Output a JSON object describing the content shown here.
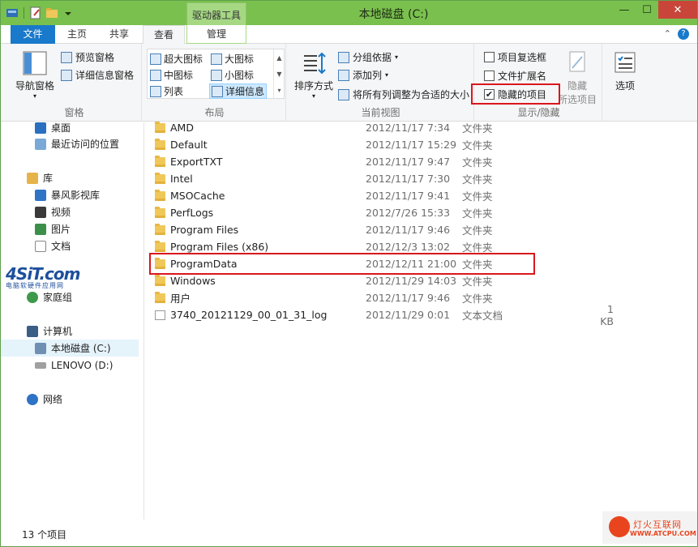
{
  "window": {
    "title": "本地磁盘 (C:)",
    "context_tab_group": "驱动器工具"
  },
  "tabs": {
    "file": "文件",
    "home": "主页",
    "share": "共享",
    "view": "查看",
    "manage": "管理"
  },
  "ribbon": {
    "pane": {
      "nav_pane": "导航窗格",
      "preview_pane": "预览窗格",
      "details_pane": "详细信息窗格",
      "label": "窗格"
    },
    "layout": {
      "xl_icons": "超大图标",
      "large_icons": "大图标",
      "medium_icons": "中图标",
      "small_icons": "小图标",
      "list": "列表",
      "details": "详细信息",
      "label": "布局"
    },
    "current_view": {
      "sort_by": "排序方式",
      "group_by": "分组依据",
      "add_column": "添加列",
      "fit_columns": "将所有列调整为合适的大小",
      "label": "当前视图"
    },
    "show_hide": {
      "item_checkboxes": "项目复选框",
      "file_extensions": "文件扩展名",
      "hidden_items": "隐藏的项目",
      "hide_selected_1": "隐藏",
      "hide_selected_2": "所选项目",
      "label": "显示/隐藏"
    },
    "options": "选项"
  },
  "nav": {
    "items": [
      {
        "label": "桌面"
      },
      {
        "label": "最近访问的位置"
      },
      {
        "label": "库"
      },
      {
        "label": "暴风影视库"
      },
      {
        "label": "视频"
      },
      {
        "label": "图片"
      },
      {
        "label": "文档"
      },
      {
        "label": "家庭组"
      },
      {
        "label": "计算机"
      },
      {
        "label": "本地磁盘 (C:)"
      },
      {
        "label": "LENOVO (D:)"
      },
      {
        "label": "网络"
      }
    ]
  },
  "files": [
    {
      "name": "AMD",
      "date": "2012/11/17 7:34",
      "type": "文件夹",
      "size": ""
    },
    {
      "name": "Default",
      "date": "2012/11/17 15:29",
      "type": "文件夹",
      "size": ""
    },
    {
      "name": "ExportTXT",
      "date": "2012/11/17 9:47",
      "type": "文件夹",
      "size": ""
    },
    {
      "name": "Intel",
      "date": "2012/11/17 7:30",
      "type": "文件夹",
      "size": ""
    },
    {
      "name": "MSOCache",
      "date": "2012/11/17 9:41",
      "type": "文件夹",
      "size": ""
    },
    {
      "name": "PerfLogs",
      "date": "2012/7/26 15:33",
      "type": "文件夹",
      "size": ""
    },
    {
      "name": "Program Files",
      "date": "2012/11/17 9:46",
      "type": "文件夹",
      "size": ""
    },
    {
      "name": "Program Files (x86)",
      "date": "2012/12/3 13:02",
      "type": "文件夹",
      "size": ""
    },
    {
      "name": "ProgramData",
      "date": "2012/12/11 21:00",
      "type": "文件夹",
      "size": ""
    },
    {
      "name": "Windows",
      "date": "2012/11/29 14:03",
      "type": "文件夹",
      "size": ""
    },
    {
      "name": "用户",
      "date": "2012/11/17 9:46",
      "type": "文件夹",
      "size": ""
    },
    {
      "name": "3740_20121129_00_01_31_log",
      "date": "2012/11/29 0:01",
      "type": "文本文档",
      "size": "1 KB"
    }
  ],
  "status": {
    "count": "13 个项目"
  },
  "watermarks": {
    "site1_big": "4SiT.com",
    "site1_small": "电脑软硬件应用网",
    "site2_title": "灯火互联网",
    "site2_url": "WWW.ATCPU.COM"
  },
  "colors": {
    "titlebar": "#7ac04e",
    "file_tab": "#1979ca",
    "highlight": "#d9171d"
  }
}
